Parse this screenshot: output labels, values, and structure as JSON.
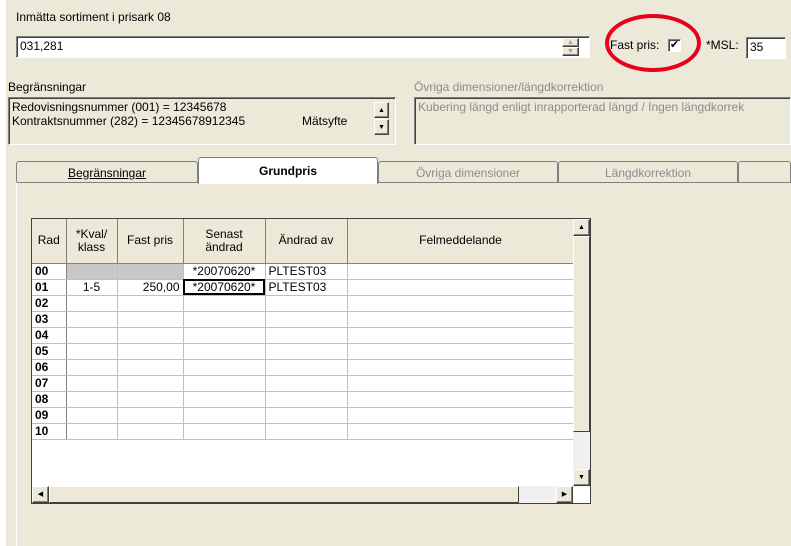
{
  "header": {
    "sortiment_label": "Inmätta sortiment i prisark 08",
    "sortiment_value": "031,281",
    "fast_pris_label": "Fast pris:",
    "fast_pris_checked": "✔",
    "msl_label": "*MSL:",
    "msl_value": "35"
  },
  "restrictions": {
    "label": "Begränsningar",
    "line1": "Redovisningsnummer (001) = 12345678",
    "line2": "Kontraktsnummer (282) = 12345678912345",
    "line2_suffix": "Mätsyfte"
  },
  "other_dims": {
    "label": "Övriga dimensioner/längdkorrektion",
    "value": "Kubering längd enligt inrapporterad längd  /  Ingen längdkorrek"
  },
  "tabs": [
    {
      "label": "Begränsningar"
    },
    {
      "label": "Grundpris"
    },
    {
      "label": "Övriga dimensioner"
    },
    {
      "label": "Längdkorrektion"
    }
  ],
  "grid": {
    "headers": [
      "Rad",
      "*Kval/ klass",
      "Fast pris",
      "Senast ändrad",
      "Ändrad av",
      "Felmeddelande"
    ],
    "rows": [
      {
        "rad": "00",
        "kval": "",
        "pris": "",
        "datum": "*20070620*",
        "av": "PLTEST03",
        "fel": ""
      },
      {
        "rad": "01",
        "kval": "1-5",
        "pris": "250,00",
        "datum": "*20070620*",
        "av": "PLTEST03",
        "fel": ""
      },
      {
        "rad": "02",
        "kval": "",
        "pris": "",
        "datum": "",
        "av": "",
        "fel": ""
      },
      {
        "rad": "03",
        "kval": "",
        "pris": "",
        "datum": "",
        "av": "",
        "fel": ""
      },
      {
        "rad": "04",
        "kval": "",
        "pris": "",
        "datum": "",
        "av": "",
        "fel": ""
      },
      {
        "rad": "05",
        "kval": "",
        "pris": "",
        "datum": "",
        "av": "",
        "fel": ""
      },
      {
        "rad": "06",
        "kval": "",
        "pris": "",
        "datum": "",
        "av": "",
        "fel": ""
      },
      {
        "rad": "07",
        "kval": "",
        "pris": "",
        "datum": "",
        "av": "",
        "fel": ""
      },
      {
        "rad": "08",
        "kval": "",
        "pris": "",
        "datum": "",
        "av": "",
        "fel": ""
      },
      {
        "rad": "09",
        "kval": "",
        "pris": "",
        "datum": "",
        "av": "",
        "fel": ""
      },
      {
        "rad": "10",
        "kval": "",
        "pris": "",
        "datum": "",
        "av": "",
        "fel": ""
      }
    ]
  },
  "colors": {
    "highlight_ring": "#e8001c",
    "window_bg": "#ece9d8"
  }
}
